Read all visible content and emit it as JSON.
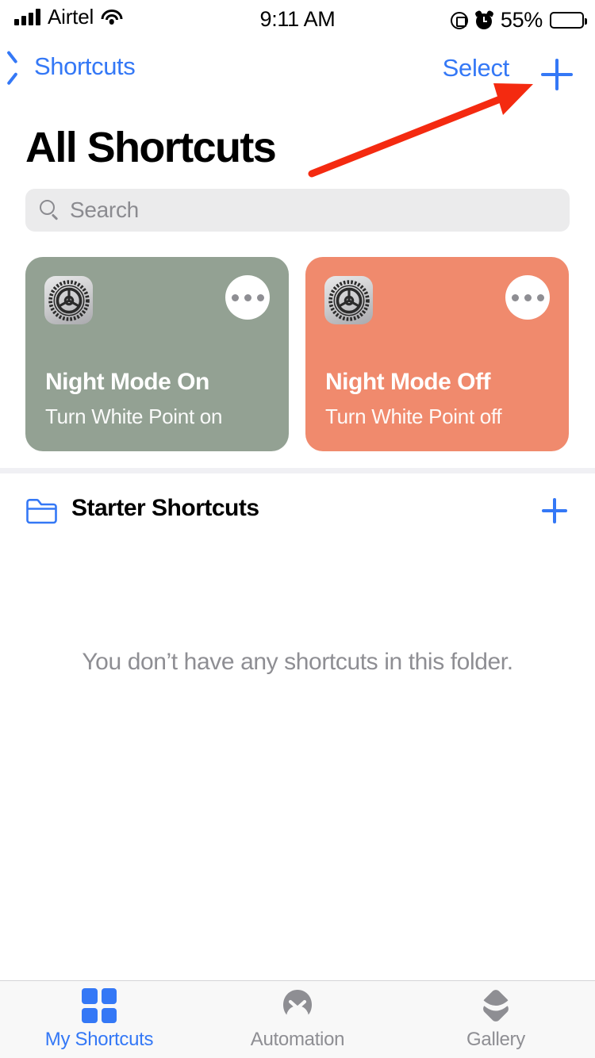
{
  "status_bar": {
    "carrier": "Airtel",
    "time": "9:11 AM",
    "battery_percent": "55%",
    "battery_level": 55,
    "signal_bars": 4,
    "icons": [
      "signal-bars-icon",
      "wifi-icon",
      "rotation-lock-icon",
      "alarm-icon",
      "battery-icon"
    ]
  },
  "nav_bar": {
    "back_label": "Shortcuts",
    "select_label": "Select",
    "add_label": "+"
  },
  "page_title": "All Shortcuts",
  "search": {
    "placeholder": "Search",
    "value": ""
  },
  "shortcuts": [
    {
      "title": "Night Mode On",
      "subtitle": "Turn White Point on",
      "color": "#93a193",
      "app_icon": "settings-gear-icon"
    },
    {
      "title": "Night Mode Off",
      "subtitle": "Turn White Point off",
      "color": "#f08a6d",
      "app_icon": "settings-gear-icon"
    }
  ],
  "folder_section": {
    "name": "Starter Shortcuts",
    "icon": "folder-icon",
    "add_label": "+",
    "empty_message": "You don’t have any shortcuts in this folder."
  },
  "tab_bar": {
    "tabs": [
      {
        "label": "My Shortcuts",
        "icon": "grid-icon",
        "active": true
      },
      {
        "label": "Automation",
        "icon": "automation-icon",
        "active": false
      },
      {
        "label": "Gallery",
        "icon": "gallery-layers-icon",
        "active": false
      }
    ]
  },
  "annotation": {
    "type": "arrow",
    "color": "#f42a10",
    "points_to": "nav-add-button"
  },
  "colors": {
    "accent_blue": "#3478f6",
    "gray_text": "#8e8e93",
    "search_background": "#ebebec",
    "tabbar_background": "#f8f8f8"
  }
}
